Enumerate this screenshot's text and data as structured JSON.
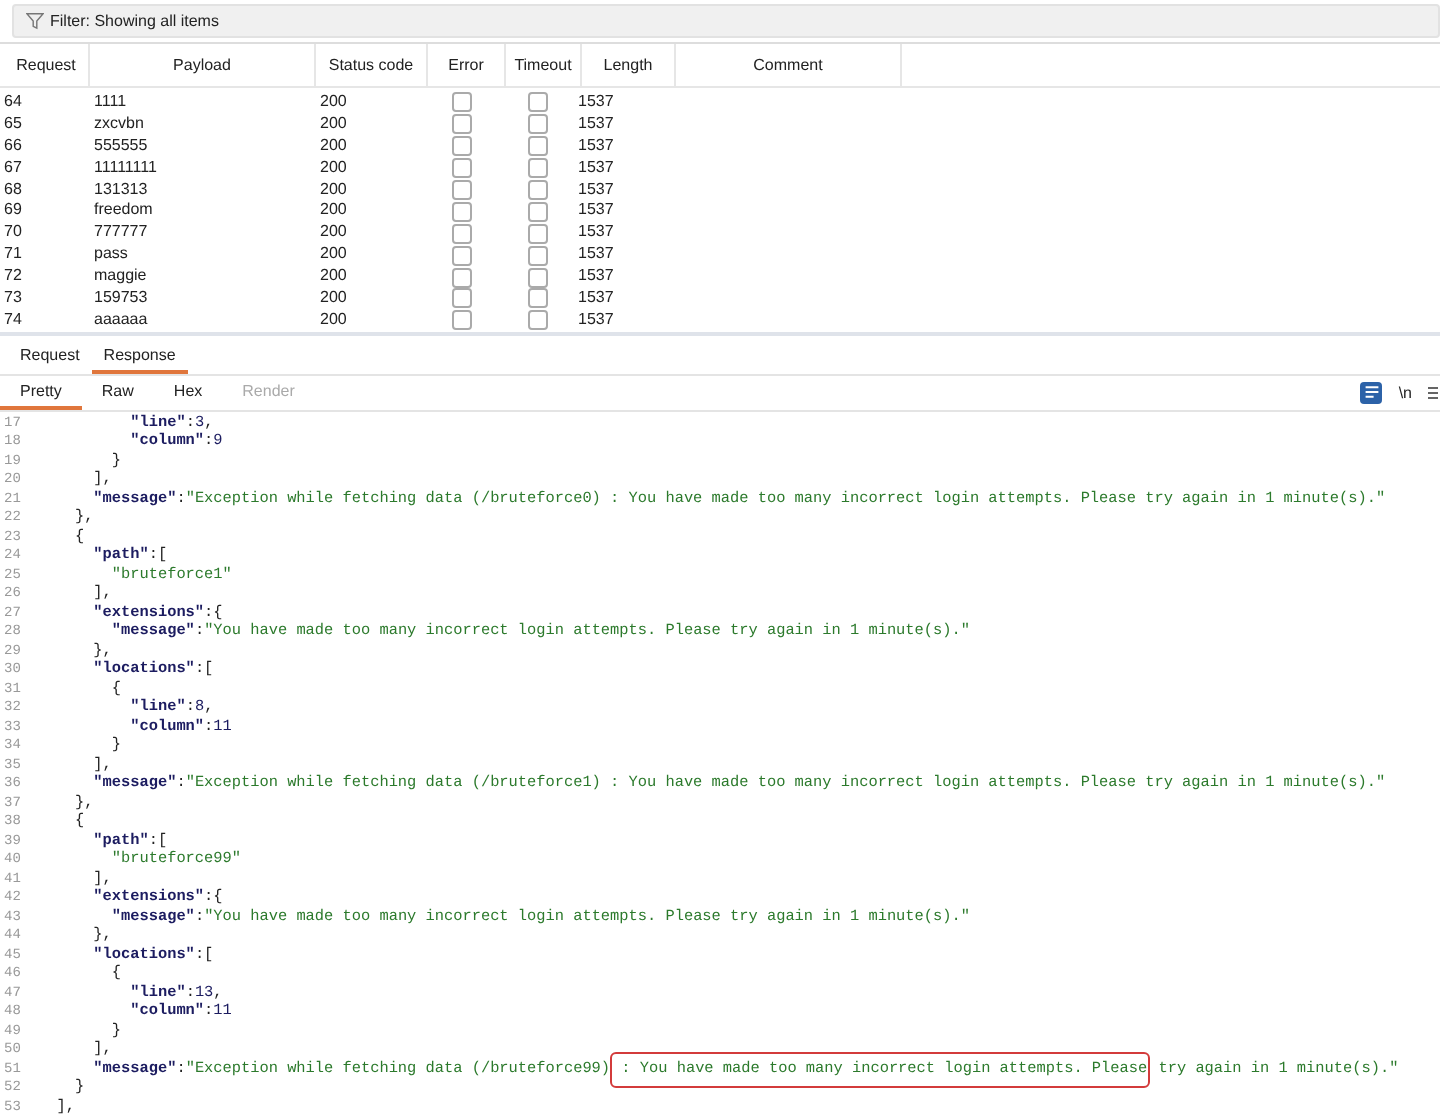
{
  "filter": {
    "label": "Filter: Showing all items"
  },
  "table": {
    "columns": [
      "Request",
      "Payload",
      "Status code",
      "Error",
      "Timeout",
      "Length",
      "Comment"
    ],
    "rows": [
      {
        "request": "64",
        "payload": "1111",
        "status": "200",
        "error": false,
        "timeout": false,
        "length": "1537"
      },
      {
        "request": "65",
        "payload": "zxcvbn",
        "status": "200",
        "error": false,
        "timeout": false,
        "length": "1537"
      },
      {
        "request": "66",
        "payload": "555555",
        "status": "200",
        "error": false,
        "timeout": false,
        "length": "1537"
      },
      {
        "request": "67",
        "payload": "11111111",
        "status": "200",
        "error": false,
        "timeout": false,
        "length": "1537"
      },
      {
        "request": "68",
        "payload": "131313",
        "status": "200",
        "error": false,
        "timeout": false,
        "length": "1537"
      },
      {
        "request": "69",
        "payload": "freedom",
        "status": "200",
        "error": false,
        "timeout": false,
        "length": "1537"
      },
      {
        "request": "70",
        "payload": "777777",
        "status": "200",
        "error": false,
        "timeout": false,
        "length": "1537"
      },
      {
        "request": "71",
        "payload": "pass",
        "status": "200",
        "error": false,
        "timeout": false,
        "length": "1537"
      },
      {
        "request": "72",
        "payload": "maggie",
        "status": "200",
        "error": false,
        "timeout": false,
        "length": "1537"
      },
      {
        "request": "73",
        "payload": "159753",
        "status": "200",
        "error": false,
        "timeout": false,
        "length": "1537"
      },
      {
        "request": "74",
        "payload": "aaaaaa",
        "status": "200",
        "error": false,
        "timeout": false,
        "length": "1537"
      }
    ]
  },
  "tabs": [
    {
      "label": "Request",
      "selected": false
    },
    {
      "label": "Response",
      "selected": true
    }
  ],
  "view_tabs": [
    {
      "label": "Pretty",
      "selected": true,
      "disabled": false
    },
    {
      "label": "Raw",
      "selected": false,
      "disabled": false
    },
    {
      "label": "Hex",
      "selected": false,
      "disabled": false
    },
    {
      "label": "Render",
      "selected": false,
      "disabled": true
    }
  ],
  "toolbar": {
    "wrap_toggle": {
      "on": true
    },
    "newline_label": "\\n"
  },
  "editor": {
    "lines": [
      {
        "number": "17",
        "tokens": [
          {
            "kind": "key",
            "text": "          \"line\""
          },
          {
            "kind": "punct",
            "text": ":"
          },
          {
            "kind": "number",
            "text": "3"
          },
          {
            "kind": "punct",
            "text": ","
          }
        ]
      },
      {
        "number": "18",
        "tokens": [
          {
            "kind": "key",
            "text": "          \"column\""
          },
          {
            "kind": "punct",
            "text": ":"
          },
          {
            "kind": "number",
            "text": "9"
          }
        ]
      },
      {
        "number": "19",
        "tokens": [
          {
            "kind": "punct",
            "text": "        }"
          }
        ]
      },
      {
        "number": "20",
        "tokens": [
          {
            "kind": "punct",
            "text": "      ],"
          }
        ]
      },
      {
        "number": "21",
        "tokens": [
          {
            "kind": "key",
            "text": "      \"message\""
          },
          {
            "kind": "punct",
            "text": ":"
          },
          {
            "kind": "string",
            "text": "\"Exception while fetching data (/bruteforce0) : You have made too many incorrect login attempts. Please try again in 1 minute(s).\""
          }
        ]
      },
      {
        "number": "22",
        "tokens": [
          {
            "kind": "punct",
            "text": "    },"
          }
        ]
      },
      {
        "number": "23",
        "tokens": [
          {
            "kind": "punct",
            "text": "    {"
          }
        ]
      },
      {
        "number": "24",
        "tokens": [
          {
            "kind": "key",
            "text": "      \"path\""
          },
          {
            "kind": "punct",
            "text": ":["
          }
        ]
      },
      {
        "number": "25",
        "tokens": [
          {
            "kind": "string",
            "text": "        \"bruteforce1\""
          }
        ]
      },
      {
        "number": "26",
        "tokens": [
          {
            "kind": "punct",
            "text": "      ],"
          }
        ]
      },
      {
        "number": "27",
        "tokens": [
          {
            "kind": "key",
            "text": "      \"extensions\""
          },
          {
            "kind": "punct",
            "text": ":{"
          }
        ]
      },
      {
        "number": "28",
        "tokens": [
          {
            "kind": "key",
            "text": "        \"message\""
          },
          {
            "kind": "punct",
            "text": ":"
          },
          {
            "kind": "string",
            "text": "\"You have made too many incorrect login attempts. Please try again in 1 minute(s).\""
          }
        ]
      },
      {
        "number": "29",
        "tokens": [
          {
            "kind": "punct",
            "text": "      },"
          }
        ]
      },
      {
        "number": "30",
        "tokens": [
          {
            "kind": "key",
            "text": "      \"locations\""
          },
          {
            "kind": "punct",
            "text": ":["
          }
        ]
      },
      {
        "number": "31",
        "tokens": [
          {
            "kind": "punct",
            "text": "        {"
          }
        ]
      },
      {
        "number": "32",
        "tokens": [
          {
            "kind": "key",
            "text": "          \"line\""
          },
          {
            "kind": "punct",
            "text": ":"
          },
          {
            "kind": "number",
            "text": "8"
          },
          {
            "kind": "punct",
            "text": ","
          }
        ]
      },
      {
        "number": "33",
        "tokens": [
          {
            "kind": "key",
            "text": "          \"column\""
          },
          {
            "kind": "punct",
            "text": ":"
          },
          {
            "kind": "number",
            "text": "11"
          }
        ]
      },
      {
        "number": "34",
        "tokens": [
          {
            "kind": "punct",
            "text": "        }"
          }
        ]
      },
      {
        "number": "35",
        "tokens": [
          {
            "kind": "punct",
            "text": "      ],"
          }
        ]
      },
      {
        "number": "36",
        "tokens": [
          {
            "kind": "key",
            "text": "      \"message\""
          },
          {
            "kind": "punct",
            "text": ":"
          },
          {
            "kind": "string",
            "text": "\"Exception while fetching data (/bruteforce1) : You have made too many incorrect login attempts. Please try again in 1 minute(s).\""
          }
        ]
      },
      {
        "number": "37",
        "tokens": [
          {
            "kind": "punct",
            "text": "    },"
          }
        ]
      },
      {
        "number": "38",
        "tokens": [
          {
            "kind": "punct",
            "text": "    {"
          }
        ]
      },
      {
        "number": "39",
        "tokens": [
          {
            "kind": "key",
            "text": "      \"path\""
          },
          {
            "kind": "punct",
            "text": ":["
          }
        ]
      },
      {
        "number": "40",
        "tokens": [
          {
            "kind": "string",
            "text": "        \"bruteforce99\""
          }
        ]
      },
      {
        "number": "41",
        "tokens": [
          {
            "kind": "punct",
            "text": "      ],"
          }
        ]
      },
      {
        "number": "42",
        "tokens": [
          {
            "kind": "key",
            "text": "      \"extensions\""
          },
          {
            "kind": "punct",
            "text": ":{"
          }
        ]
      },
      {
        "number": "43",
        "tokens": [
          {
            "kind": "key",
            "text": "        \"message\""
          },
          {
            "kind": "punct",
            "text": ":"
          },
          {
            "kind": "string",
            "text": "\"You have made too many incorrect login attempts. Please try again in 1 minute(s).\""
          }
        ]
      },
      {
        "number": "44",
        "tokens": [
          {
            "kind": "punct",
            "text": "      },"
          }
        ]
      },
      {
        "number": "45",
        "tokens": [
          {
            "kind": "key",
            "text": "      \"locations\""
          },
          {
            "kind": "punct",
            "text": ":["
          }
        ]
      },
      {
        "number": "46",
        "tokens": [
          {
            "kind": "punct",
            "text": "        {"
          }
        ]
      },
      {
        "number": "47",
        "tokens": [
          {
            "kind": "key",
            "text": "          \"line\""
          },
          {
            "kind": "punct",
            "text": ":"
          },
          {
            "kind": "number",
            "text": "13"
          },
          {
            "kind": "punct",
            "text": ","
          }
        ]
      },
      {
        "number": "48",
        "tokens": [
          {
            "kind": "key",
            "text": "          \"column\""
          },
          {
            "kind": "punct",
            "text": ":"
          },
          {
            "kind": "number",
            "text": "11"
          }
        ]
      },
      {
        "number": "49",
        "tokens": [
          {
            "kind": "punct",
            "text": "        }"
          }
        ]
      },
      {
        "number": "50",
        "tokens": [
          {
            "kind": "punct",
            "text": "      ],"
          }
        ]
      },
      {
        "number": "51",
        "tokens": [
          {
            "kind": "key",
            "text": "      \"message\""
          },
          {
            "kind": "punct",
            "text": ":"
          },
          {
            "kind": "string",
            "text": "\"Exception while fetching data (/bruteforce99)"
          },
          {
            "kind": "boxed",
            "text": " : You have made too many incorrect login attempts. Please"
          },
          {
            "kind": "string",
            "text": " try again in 1 minute(s).\""
          }
        ]
      },
      {
        "number": "52",
        "tokens": [
          {
            "kind": "punct",
            "text": "    }"
          }
        ]
      },
      {
        "number": "53",
        "tokens": [
          {
            "kind": "punct",
            "text": "  ],"
          }
        ]
      }
    ]
  }
}
